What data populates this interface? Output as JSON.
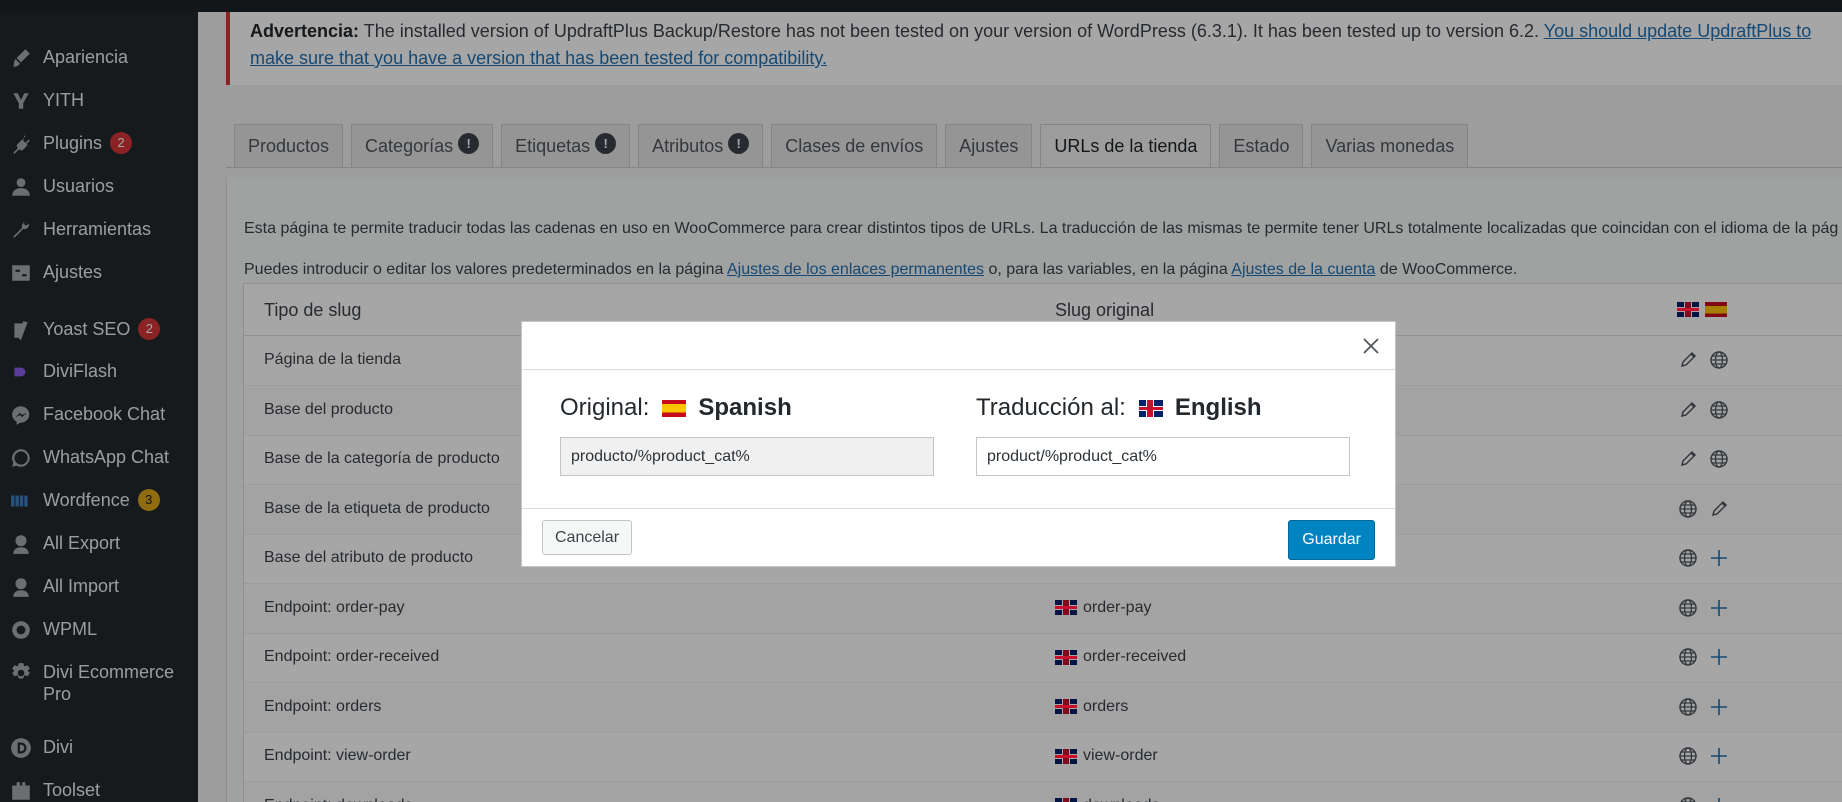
{
  "colors": {
    "sidebar_bg": "#23282d",
    "accent": "#2271b1",
    "notice_border": "#d63638",
    "save_button": "#0083c1"
  },
  "sidebar": {
    "items": [
      {
        "label": "Apariencia",
        "icon": "brush-icon"
      },
      {
        "label": "YITH",
        "icon": "yith-icon"
      },
      {
        "label": "Plugins",
        "icon": "plugin-icon",
        "badge": "2"
      },
      {
        "label": "Usuarios",
        "icon": "user-icon"
      },
      {
        "label": "Herramientas",
        "icon": "wrench-icon"
      },
      {
        "label": "Ajustes",
        "icon": "settings-icon"
      },
      {
        "label": "Yoast SEO",
        "icon": "yoast-icon",
        "badge": "2"
      },
      {
        "label": "DiviFlash",
        "icon": "diviflash-icon"
      },
      {
        "label": "Facebook Chat",
        "icon": "messenger-icon"
      },
      {
        "label": "WhatsApp Chat",
        "icon": "whatsapp-icon"
      },
      {
        "label": "Wordfence",
        "icon": "wordfence-icon",
        "badge": "3"
      },
      {
        "label": "All Export",
        "icon": "export-icon"
      },
      {
        "label": "All Import",
        "icon": "import-icon"
      },
      {
        "label": "WPML",
        "icon": "wpml-icon"
      },
      {
        "label": "Divi Ecommerce Pro",
        "icon": "gear-icon"
      },
      {
        "label": "Divi",
        "icon": "divi-icon"
      },
      {
        "label": "Toolset",
        "icon": "toolset-icon"
      }
    ]
  },
  "notice": {
    "label": "Advertencia:",
    "text": " The installed version of UpdraftPlus Backup/Restore has not been tested on your version of WordPress (6.3.1). It has been tested up to version 6.2. ",
    "link_line1": "You should update UpdraftPlus to",
    "link_line2": "make sure that you have a version that has been tested for compatibility."
  },
  "tabs": [
    {
      "label": "Productos"
    },
    {
      "label": "Categorías",
      "warn": "!"
    },
    {
      "label": "Etiquetas",
      "warn": "!"
    },
    {
      "label": "Atributos",
      "warn": "!"
    },
    {
      "label": "Clases de envíos"
    },
    {
      "label": "Ajustes"
    },
    {
      "label": "URLs de la tienda",
      "active": true
    },
    {
      "label": "Estado"
    },
    {
      "label": "Varias monedas"
    }
  ],
  "intro": {
    "line1": "Esta página te permite traducir todas las cadenas en uso en WooCommerce para crear distintos tipos de URLs. La traducción de las mismas te permite tener URLs totalmente localizadas que coincidan con el idioma de la pág",
    "line2_a": "Puedes introducir o editar los valores predeterminados en la página ",
    "link1": "Ajustes de los enlaces permanentes",
    "line2_b": " o, para las variables, en la página ",
    "link2": "Ajustes de la cuenta",
    "line2_c": " de WooCommerce."
  },
  "table": {
    "col_type": "Tipo de slug",
    "col_original": "Slug original",
    "rows": [
      {
        "type": "Página de la tienda",
        "original": ""
      },
      {
        "type": "Base del producto",
        "original": ""
      },
      {
        "type": "Base de la categoría de producto",
        "original": ""
      },
      {
        "type": "Base de la etiqueta de producto",
        "original": ""
      },
      {
        "type": "Base del atributo de producto",
        "original": ""
      },
      {
        "type": "Endpoint: order-pay",
        "original": "order-pay"
      },
      {
        "type": "Endpoint: order-received",
        "original": "order-received"
      },
      {
        "type": "Endpoint: orders",
        "original": "orders"
      },
      {
        "type": "Endpoint: view-order",
        "original": "view-order"
      },
      {
        "type": "Endpoint: downloads",
        "original": "downloads"
      }
    ]
  },
  "modal": {
    "original_label": "Original:",
    "original_lang": "Spanish",
    "original_value": "producto/%product_cat%",
    "translation_label": "Traducción al:",
    "translation_lang": "English",
    "translation_value": "product/%product_cat%",
    "cancel": "Cancelar",
    "save": "Guardar"
  }
}
